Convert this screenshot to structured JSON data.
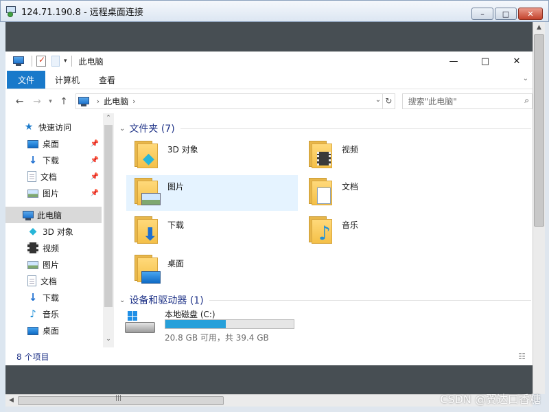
{
  "rdp": {
    "title": "124.71.190.8 - 远程桌面连接",
    "buttons": [
      "–",
      "□",
      "✕"
    ]
  },
  "explorer": {
    "title": "此电脑",
    "window_controls": [
      "—",
      "□",
      "✕"
    ],
    "ribbon_tabs": [
      "文件",
      "计算机",
      "查看"
    ],
    "address": {
      "crumb": "此电脑",
      "search_placeholder": "搜索\"此电脑\""
    },
    "nav": {
      "quick_access": "快速访问",
      "quick_items": [
        "桌面",
        "下载",
        "文档",
        "图片"
      ],
      "this_pc": "此电脑",
      "pc_items": [
        "3D 对象",
        "视频",
        "图片",
        "文档",
        "下载",
        "音乐",
        "桌面"
      ]
    },
    "folders_group": "文件夹 (7)",
    "folders": [
      "3D 对象",
      "视频",
      "图片",
      "文档",
      "下载",
      "音乐",
      "桌面"
    ],
    "devices_group": "设备和驱动器 (1)",
    "drive": {
      "name": "本地磁盘 (C:)",
      "free_text": "20.8 GB 可用，共 39.4 GB",
      "used_fraction": 0.472
    },
    "status": "8 个项目"
  },
  "watermark": "CSDN @翼达口香糖",
  "colors": {
    "accent": "#1979ca",
    "drive_fill": "#26a0da",
    "group_header": "#1e3287",
    "hover": "#e5f3ff"
  }
}
